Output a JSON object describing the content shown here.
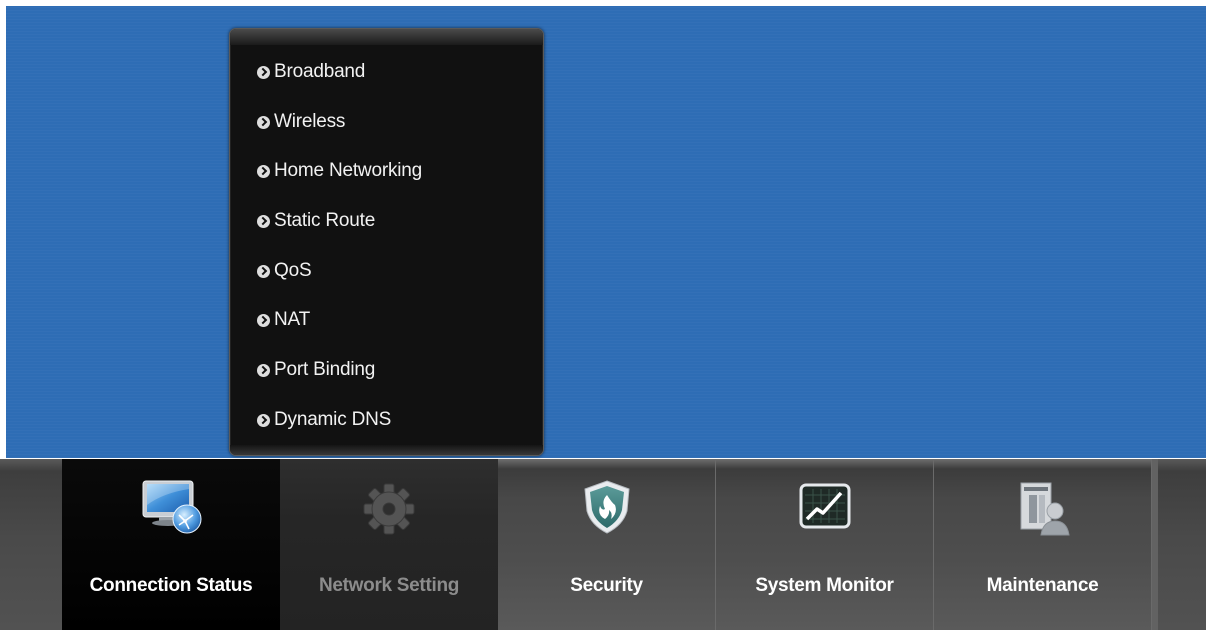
{
  "dropdown": {
    "items": [
      {
        "label": "Broadband"
      },
      {
        "label": "Wireless"
      },
      {
        "label": "Home Networking"
      },
      {
        "label": "Static Route"
      },
      {
        "label": "QoS"
      },
      {
        "label": "NAT"
      },
      {
        "label": "Port Binding"
      },
      {
        "label": "Dynamic DNS"
      }
    ]
  },
  "navbar": {
    "tabs": [
      {
        "label": "Connection Status",
        "icon": "monitor-globe-icon",
        "state": "active"
      },
      {
        "label": "Network Setting",
        "icon": "gear-icon",
        "state": "hover"
      },
      {
        "label": "Security",
        "icon": "shield-icon",
        "state": "normal"
      },
      {
        "label": "System Monitor",
        "icon": "chart-monitor-icon",
        "state": "normal"
      },
      {
        "label": "Maintenance",
        "icon": "maintenance-person-icon",
        "state": "normal"
      }
    ]
  },
  "colors": {
    "backdrop": "#2e6db5",
    "dropdown_bg": "#111111",
    "navbar": "#4e4e4e",
    "active_tab": "#000000"
  }
}
